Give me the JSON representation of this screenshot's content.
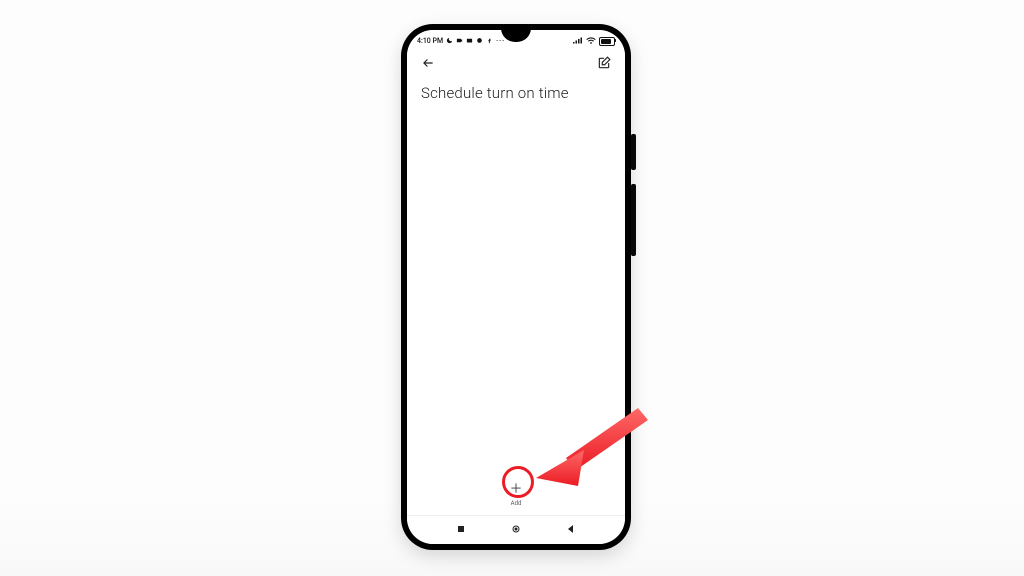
{
  "status": {
    "time": "4:10 PM",
    "left_icons": [
      "moon-icon",
      "video-icon",
      "camera-icon",
      "circle-icon",
      "facebook-icon",
      "more-icon"
    ],
    "right_icons": [
      "signal-icon",
      "wifi-icon",
      "battery-icon"
    ]
  },
  "appbar": {
    "back_icon": "back-arrow",
    "edit_icon": "edit-compose"
  },
  "page": {
    "title": "Schedule turn on time"
  },
  "add": {
    "label": "Add",
    "icon": "plus-icon"
  },
  "nav": {
    "recent": "recent-apps",
    "home": "home",
    "back": "back"
  },
  "annotation": {
    "color": "#eb1c24",
    "shape": "arrow-pointing-to-add"
  }
}
